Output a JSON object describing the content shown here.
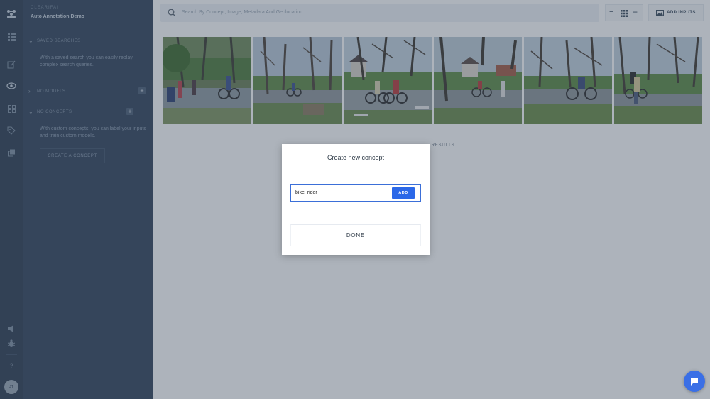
{
  "brand": "CLEARIFAI",
  "app_name": "Auto Annotation Demo",
  "user_initials": "JT",
  "sidebar": {
    "saved_searches_label": "SAVED SEARCHES",
    "saved_searches_desc": "With a saved search you can easily replay complex search queries.",
    "models_label": "NO MODELS",
    "concepts_label": "NO CONCEPTS",
    "concepts_desc": "With custom concepts, you can label your inputs and train custom models.",
    "create_concept_button": "CREATE A CONCEPT"
  },
  "search": {
    "placeholder": "Search By Concept, Image, Metadata And Geolocation"
  },
  "toolbar": {
    "add_inputs_label": "ADD INPUTS"
  },
  "results_label": "5 RESULTS",
  "modal": {
    "title": "Create new concept",
    "input_value": "bike_rider",
    "add_label": "ADD",
    "done_label": "DONE"
  },
  "photos": [
    {
      "name": "photo-1"
    },
    {
      "name": "photo-2"
    },
    {
      "name": "photo-3"
    },
    {
      "name": "photo-4"
    },
    {
      "name": "photo-5"
    },
    {
      "name": "photo-6"
    }
  ],
  "colors": {
    "accent": "#2b68e8",
    "sidebar": "#31435a",
    "rail": "#2b3b50"
  }
}
